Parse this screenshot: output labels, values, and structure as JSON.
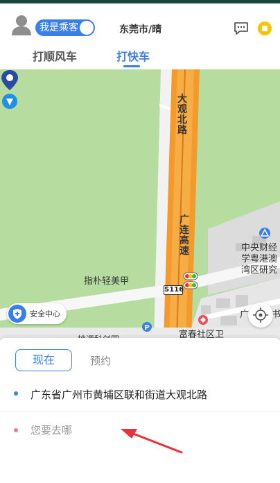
{
  "header": {
    "role_toggle_label": "我是乘客",
    "city_weather": "东莞市/晴",
    "tabs": [
      {
        "label": "打顺风车",
        "active": false
      },
      {
        "label": "打快车",
        "active": true
      }
    ]
  },
  "map": {
    "road_major": "大观北路",
    "road_highway": "广连高速",
    "route_badge": "S116",
    "poi_pin": "指朴轻美甲",
    "poi_institute_1": "中央财经",
    "poi_institute_2": "学粤港澳",
    "poi_institute_3": "湾区研究",
    "poi_community": "富春社区卫",
    "poi_right_1": "广",
    "poi_right_2": "书",
    "poi_bottom": "桃源科创园",
    "safety_center_label": "安全中心"
  },
  "trip": {
    "time_now_label": "现在",
    "time_reserve_label": "预约",
    "from_address": "广东省广州市黄埔区联和街道大观北路",
    "to_placeholder": "您要去哪"
  },
  "colors": {
    "accent": "#3b7fe8",
    "destination_dot": "#f07a98",
    "arrow": "#e8323c",
    "map_green": "#b6dca0",
    "road_orange": "#f39a2b"
  }
}
